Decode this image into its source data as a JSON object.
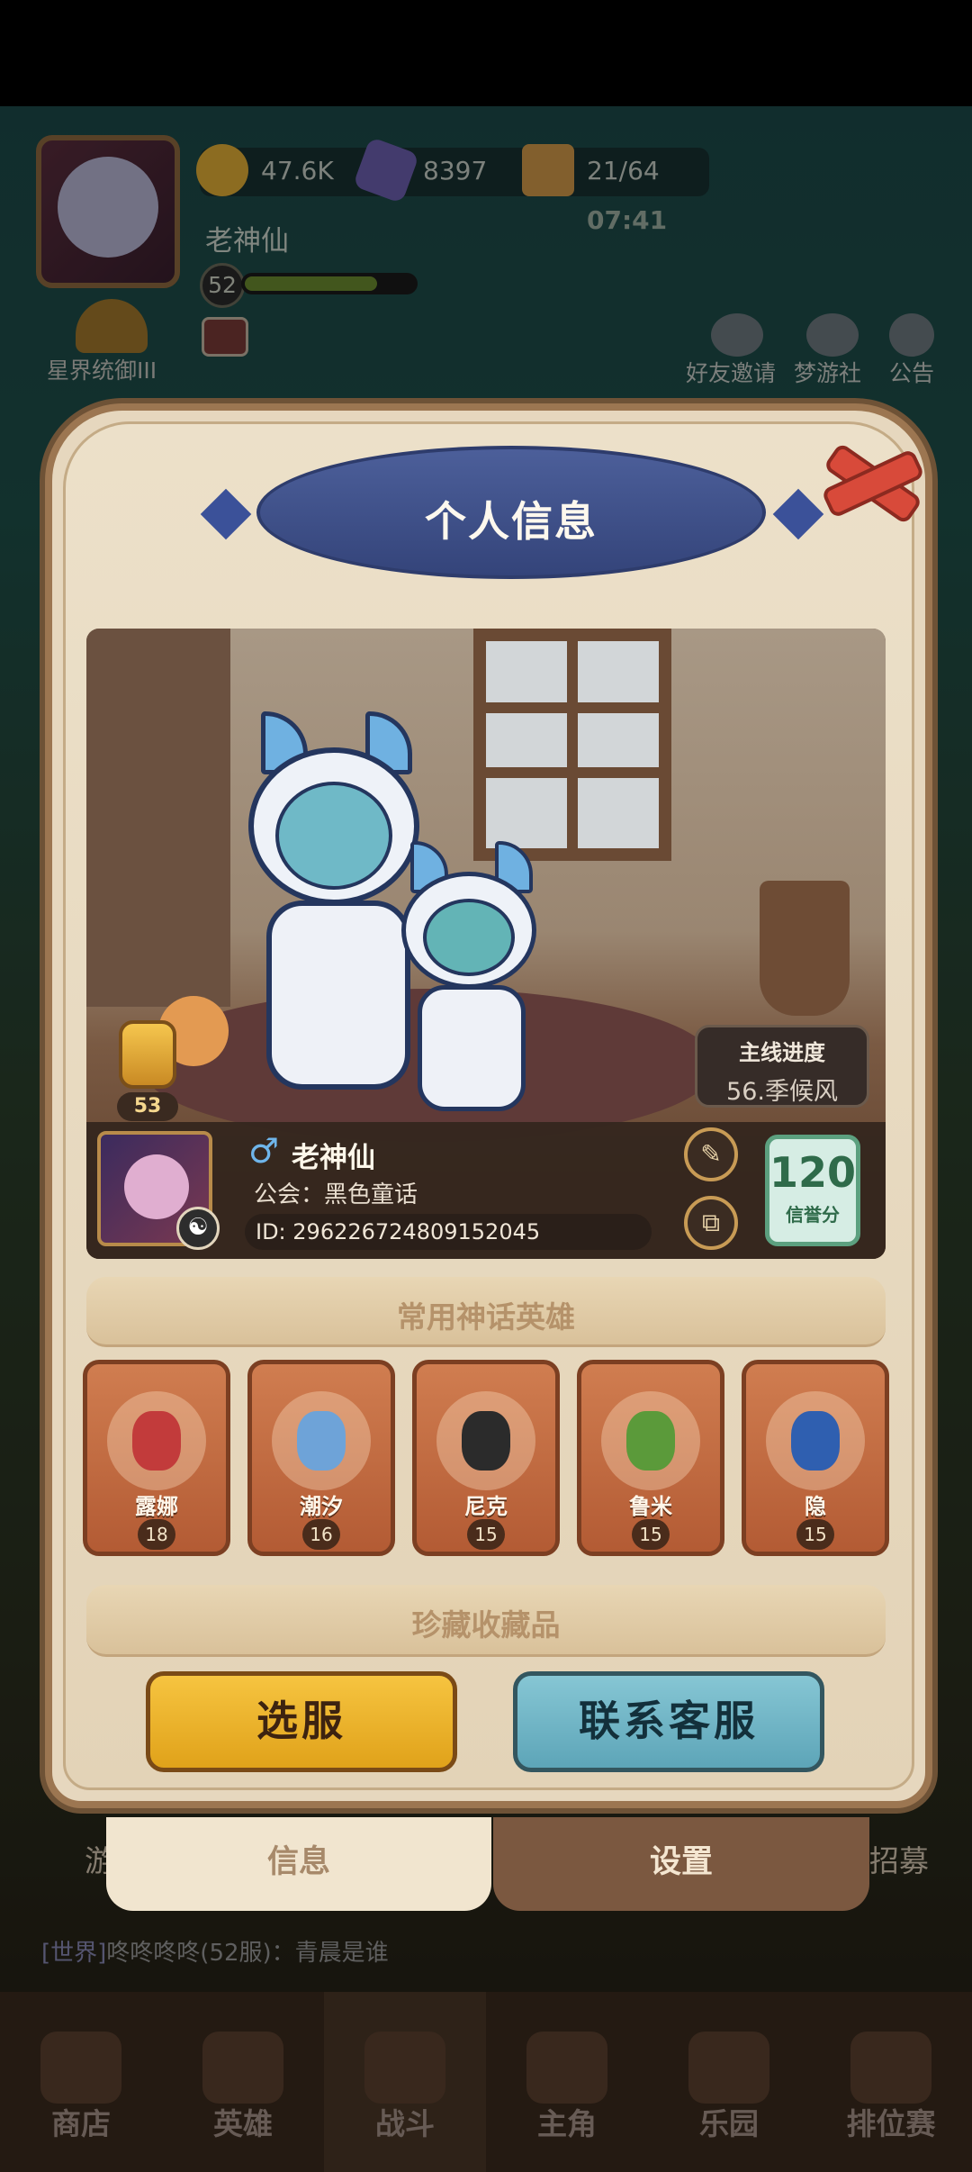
{
  "hud": {
    "gold": "47.6K",
    "stars": "8397",
    "energy": "21/64",
    "timer": "07:41",
    "player_name": "老神仙",
    "level": "52",
    "level_progress": 0.78,
    "rank_title": "星界统御III",
    "links": [
      "好友邀请",
      "梦游社",
      "公告"
    ]
  },
  "modal": {
    "title": "个人信息",
    "likes": "53",
    "main_progress_label": "主线进度",
    "main_progress_value": "56.季候风",
    "gender_symbol": "♂",
    "name": "老神仙",
    "guild": "公会：黑色童话",
    "id": "ID: 29622672480915204​5",
    "credit_score": "120",
    "credit_label": "信誉分",
    "heroes_section": "常用神话英雄",
    "heroes": [
      {
        "name": "露娜",
        "level": "18",
        "color": "#c23b3b"
      },
      {
        "name": "潮汐",
        "level": "16",
        "color": "#6ea3d8"
      },
      {
        "name": "尼克",
        "level": "15",
        "color": "#2b2b2b"
      },
      {
        "name": "鲁米",
        "level": "15",
        "color": "#5b9a3a"
      },
      {
        "name": "隐",
        "level": "15",
        "color": "#2f5fb0"
      }
    ],
    "collection_section": "珍藏收藏品",
    "btn_server": "选服",
    "btn_support": "联系客服",
    "tab_info": "信息",
    "tab_settings": "设置"
  },
  "chat": {
    "channel": "[世界]",
    "text": "咚咚咚咚(52服)：青晨是谁"
  },
  "side": {
    "left_stub": "游",
    "right_stub": "招募"
  },
  "bottom_nav": [
    "商店",
    "英雄",
    "战斗",
    "主角",
    "乐园",
    "排位赛"
  ],
  "icons": {
    "gold": "coin-icon",
    "stars": "star-icon",
    "energy": "biscuit-icon",
    "close": "close-icon",
    "edit": "edit-icon",
    "copy": "copy-icon"
  },
  "colors": {
    "accent_yellow": "#e0a21a",
    "accent_blue": "#5da5b8",
    "close_red": "#d84a3a",
    "credit_green": "#2f6b4a"
  }
}
